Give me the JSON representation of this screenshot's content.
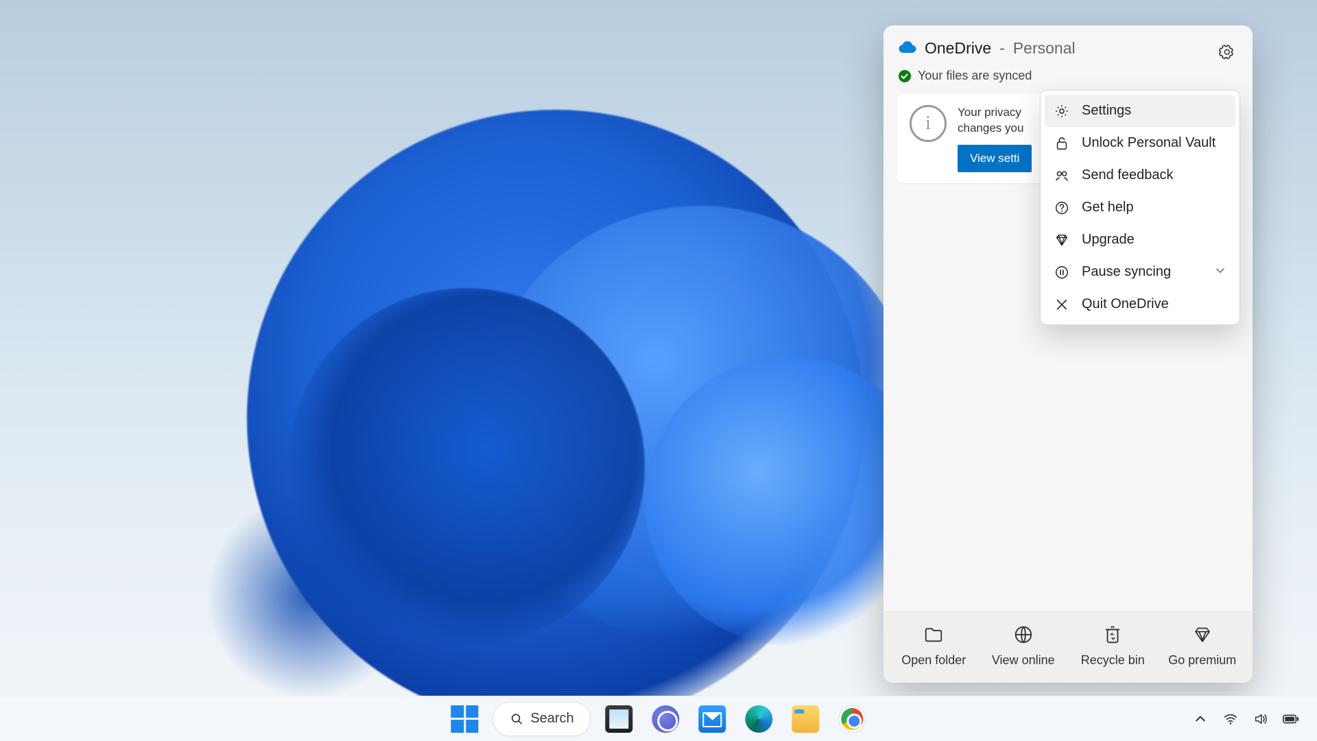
{
  "flyout": {
    "app": "OneDrive",
    "separator": "-",
    "account": "Personal",
    "sync_status": "Your files are synced",
    "card": {
      "line1": "Your privacy",
      "line2": "changes you",
      "button": "View setti"
    },
    "bottom": {
      "open_folder": "Open folder",
      "view_online": "View online",
      "recycle_bin": "Recycle bin",
      "go_premium": "Go premium"
    }
  },
  "menu": {
    "settings": "Settings",
    "unlock_vault": "Unlock Personal Vault",
    "send_feedback": "Send feedback",
    "get_help": "Get help",
    "upgrade": "Upgrade",
    "pause_syncing": "Pause syncing",
    "quit": "Quit OneDrive"
  },
  "taskbar": {
    "search": "Search"
  }
}
